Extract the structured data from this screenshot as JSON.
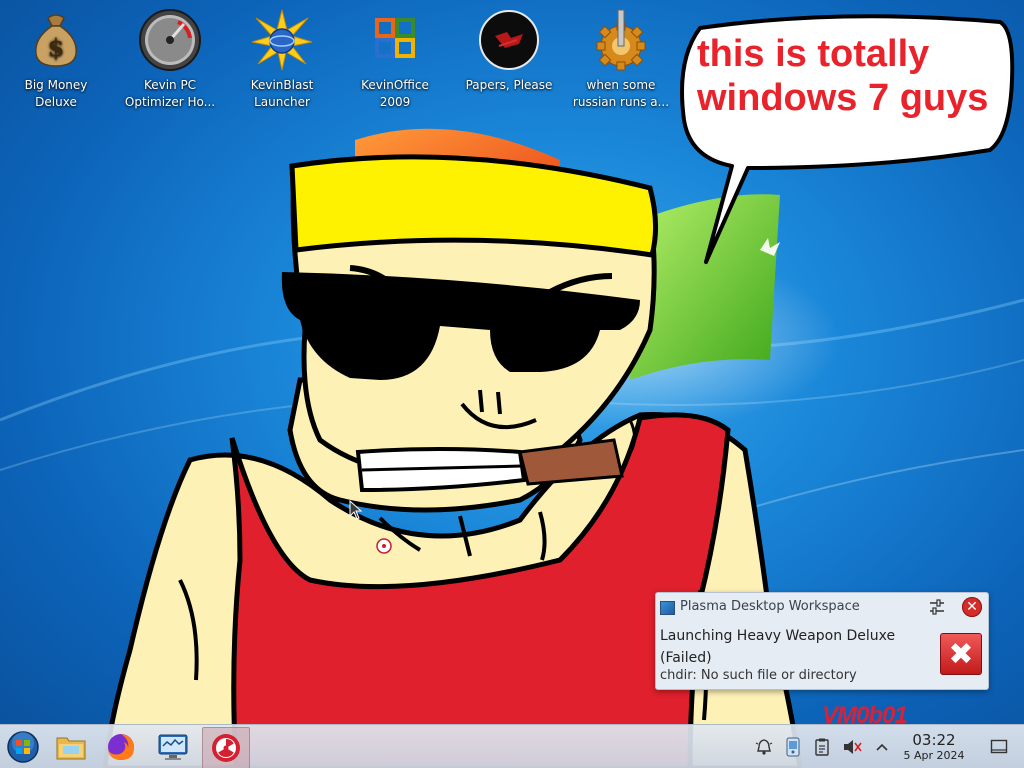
{
  "desktop": {
    "icons": [
      {
        "name": "big-money-deluxe",
        "line1": "Big Money",
        "line2": "Deluxe",
        "glyph": "money-bag-icon"
      },
      {
        "name": "kevin-pc-optimizer",
        "line1": "Kevin PC",
        "line2": "Optimizer Ho...",
        "glyph": "gauge-icon"
      },
      {
        "name": "kevinblast-launcher",
        "line1": "KevinBlast",
        "line2": "Launcher",
        "glyph": "sun-burst-icon"
      },
      {
        "name": "kevinoffice-2009",
        "line1": "KevinOffice",
        "line2": "2009",
        "glyph": "office-logo-icon"
      },
      {
        "name": "papers-please",
        "line1": "Papers, Please",
        "line2": "",
        "glyph": "emblem-icon"
      },
      {
        "name": "when-some-russian",
        "line1": "when some",
        "line2": "russian runs a...",
        "glyph": "gear-lever-icon"
      }
    ]
  },
  "bubble": {
    "line1": "this is totally",
    "line2": "windows 7 guys"
  },
  "notification": {
    "app_name": "Plasma Desktop Workspace",
    "title_line1": "Launching Heavy Weapon Deluxe",
    "title_line2": "(Failed)",
    "body": "chdir: No such file or directory",
    "close_glyph": "✕",
    "error_glyph": "✖"
  },
  "watermark": "VM0b01",
  "taskbar": {
    "apps": [
      "start-orb-icon",
      "file-manager-icon",
      "firefox-icon",
      "system-monitor-icon",
      "radiation-app-icon"
    ],
    "tray": [
      "notifications-bell-icon",
      "device-icon",
      "clipboard-icon",
      "volume-muted-icon",
      "tray-expand-icon"
    ],
    "clock_time": "03:22",
    "clock_date": "5 Apr 2024",
    "expand_glyph": "^"
  },
  "colors": {
    "bubble_text": "#e8232b",
    "shirt": "#e0202c",
    "headband": "#fff200",
    "skin": "#fdf1b6",
    "watermark": "#d4233a"
  }
}
